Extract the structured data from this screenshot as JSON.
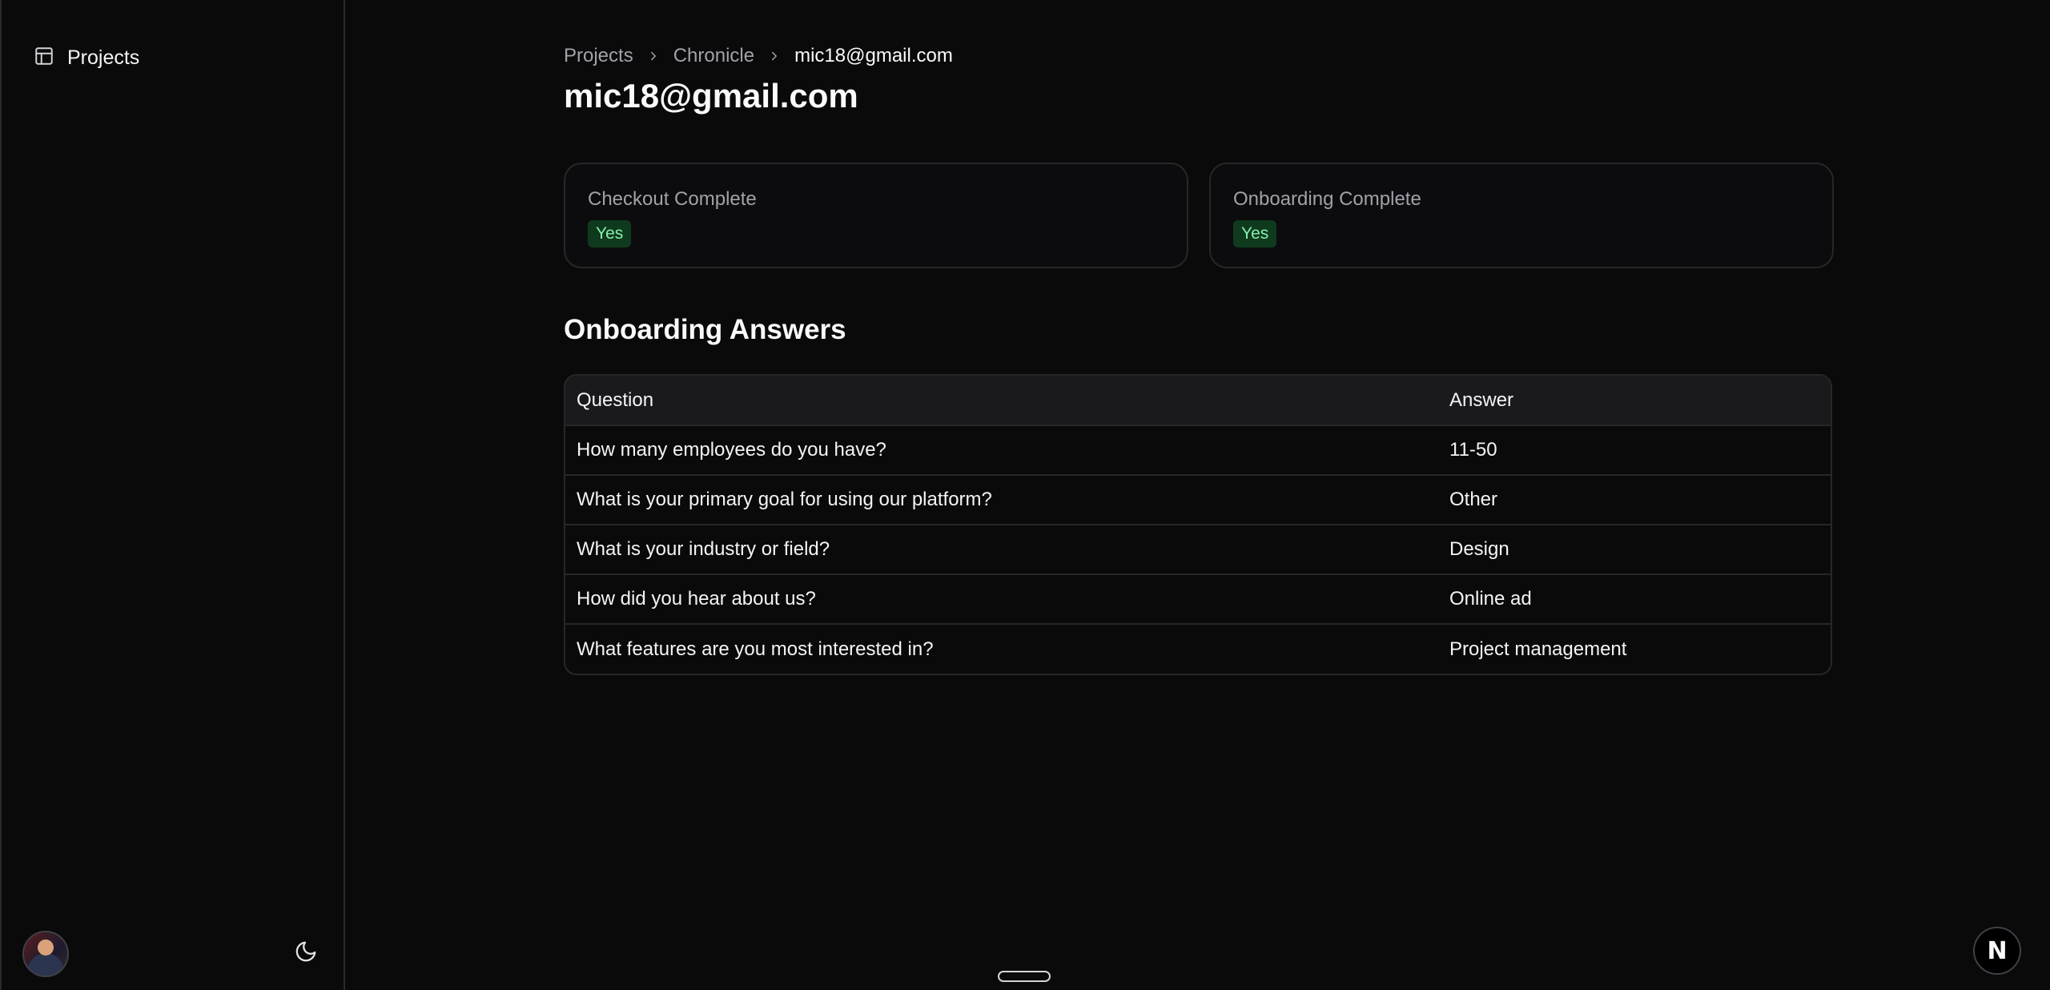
{
  "sidebar": {
    "items": [
      {
        "label": "Projects",
        "icon": "layout-panel-icon"
      }
    ]
  },
  "breadcrumb": {
    "items": [
      "Projects",
      "Chronicle",
      "mic18@gmail.com"
    ]
  },
  "page": {
    "title": "mic18@gmail.com"
  },
  "status_cards": [
    {
      "label": "Checkout Complete",
      "value": "Yes"
    },
    {
      "label": "Onboarding Complete",
      "value": "Yes"
    }
  ],
  "onboarding": {
    "title": "Onboarding Answers",
    "columns": [
      "Question",
      "Answer"
    ],
    "rows": [
      {
        "question": "How many employees do you have?",
        "answer": "11-50"
      },
      {
        "question": "What is your primary goal for using our platform?",
        "answer": "Other"
      },
      {
        "question": "What is your industry or field?",
        "answer": "Design"
      },
      {
        "question": "How did you hear about us?",
        "answer": "Online ad"
      },
      {
        "question": "What features are you most interested in?",
        "answer": "Project management"
      }
    ]
  },
  "fab": {
    "label": "N"
  },
  "colors": {
    "background": "#0a0a0b",
    "border": "#27272a",
    "badge_bg": "#0f3a1e",
    "badge_text": "#86efac"
  }
}
